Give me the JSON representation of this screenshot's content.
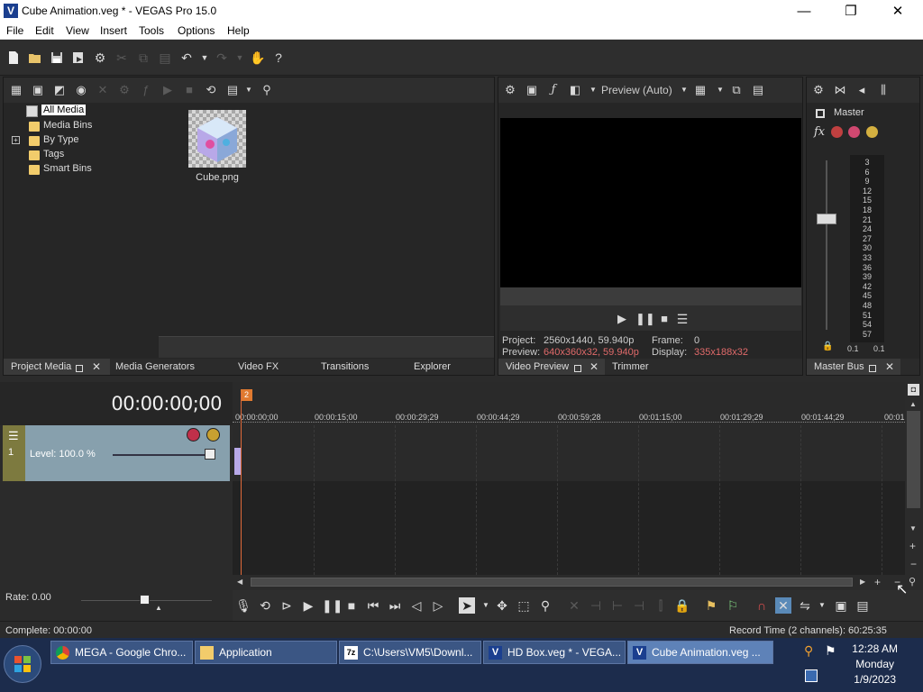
{
  "window": {
    "title": "Cube Animation.veg * - VEGAS Pro 15.0",
    "app_icon_letter": "V",
    "controls": {
      "minimize": "—",
      "maximize": "❐",
      "close": "✕"
    }
  },
  "menu": [
    "File",
    "Edit",
    "View",
    "Insert",
    "Tools",
    "Options",
    "Help"
  ],
  "project_media": {
    "tree": [
      {
        "label": "All Media",
        "selected": true
      },
      {
        "label": "Media Bins"
      },
      {
        "label": "By Type",
        "expandable": true
      },
      {
        "label": "Tags"
      },
      {
        "label": "Smart Bins"
      }
    ],
    "expander": "+",
    "media_items": [
      {
        "name": "Cube.png"
      }
    ],
    "tabs": {
      "project_media": "Project Media",
      "media_generators": "Media Generators",
      "video_fx": "Video FX",
      "transitions": "Transitions",
      "explorer": "Explorer"
    }
  },
  "preview": {
    "mode": "Preview (Auto)",
    "project_label": "Project:",
    "project_value": "2560x1440, 59.940p",
    "preview_label": "Preview:",
    "preview_value": "640x360x32, 59.940p",
    "frame_label": "Frame:",
    "frame_value": "0",
    "display_label": "Display:",
    "display_value": "335x188x32",
    "tabs": {
      "video_preview": "Video Preview",
      "trimmer": "Trimmer"
    }
  },
  "master": {
    "label": "Master",
    "fx_label": "fx",
    "meter_scale": [
      "3",
      "6",
      "9",
      "12",
      "15",
      "18",
      "21",
      "24",
      "27",
      "30",
      "33",
      "36",
      "39",
      "42",
      "45",
      "48",
      "51",
      "54",
      "57"
    ],
    "peak_left": "0.1",
    "peak_right": "0.1",
    "tab": "Master Bus"
  },
  "timeline": {
    "timecode": "00:00:00;00",
    "ruler_labels": [
      "00:00:00;00",
      "00:00:15;00",
      "00:00:29;29",
      "00:00:44;29",
      "00:00:59;28",
      "00:01:15;00",
      "00:01:29;29",
      "00:01:44;29",
      "00:01"
    ],
    "marker": "2",
    "track_level": "Level: 100.0 %",
    "track_number": "1",
    "rate": "Rate: 0.00"
  },
  "status": {
    "complete": "Complete: 00:00:00",
    "record_time": "Record Time (2 channels): 60:25:35"
  },
  "taskbar": {
    "tasks": [
      {
        "label": "MEGA - Google Chro..."
      },
      {
        "label": "Application"
      },
      {
        "label": "C:\\Users\\VM5\\Downl..."
      },
      {
        "label": "HD Box.veg * - VEGA..."
      },
      {
        "label": "Cube Animation.veg ..."
      }
    ],
    "time": "12:28 AM",
    "day": "Monday",
    "date": "1/9/2023"
  },
  "colors": {
    "accent_red": "#e06a6a",
    "track_color": "#87a0ad",
    "track_strip": "#7d7a3f",
    "taskbar": "#1c2c4c"
  }
}
